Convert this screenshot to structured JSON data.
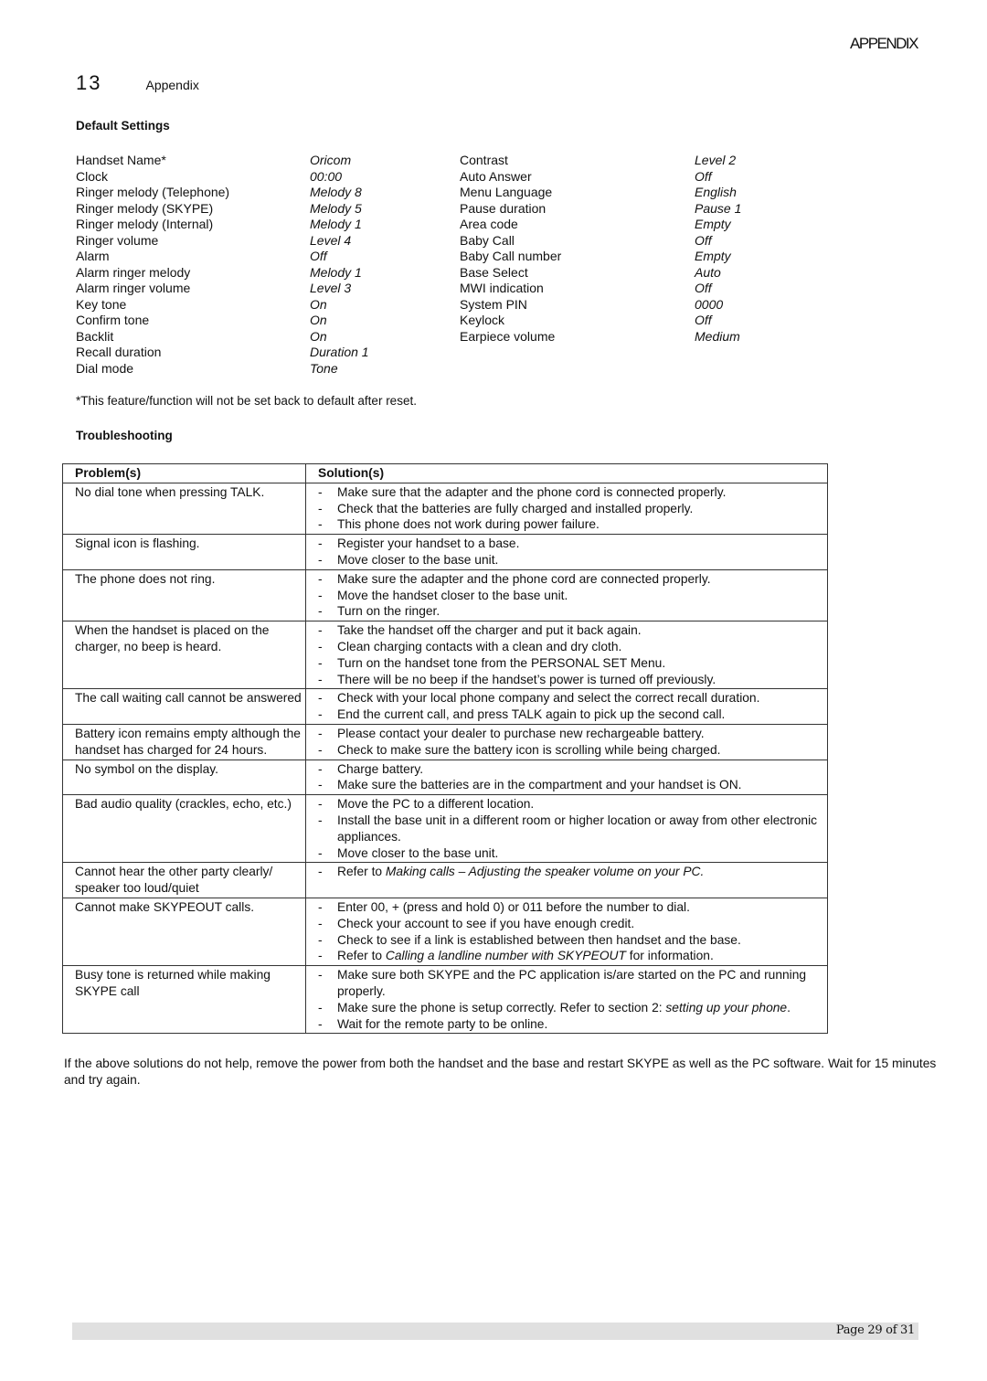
{
  "header": {
    "title": "APPENDIX"
  },
  "chapter": {
    "number": "13",
    "name": "Appendix"
  },
  "default_settings": {
    "heading": "Default Settings",
    "left": [
      {
        "name": "Handset Name*",
        "value": "Oricom"
      },
      {
        "name": "Clock",
        "value": "00:00"
      },
      {
        "name": "Ringer melody  (Telephone)",
        "value": "Melody 8"
      },
      {
        "name": "Ringer melody (SKYPE)",
        "value": "Melody 5"
      },
      {
        "name": "Ringer melody (Internal)",
        "value": "Melody 1"
      },
      {
        "name": "Ringer volume",
        "value": "Level 4"
      },
      {
        "name": "Alarm",
        "value": "Off"
      },
      {
        "name": "Alarm ringer melody",
        "value": "Melody 1"
      },
      {
        "name": "Alarm ringer volume",
        "value": "Level 3"
      },
      {
        "name": "Key tone",
        "value": "On"
      },
      {
        "name": "Confirm tone",
        "value": "On"
      },
      {
        "name": "Backlit",
        "value": "On"
      },
      {
        "name": "Recall duration",
        "value": "Duration 1"
      },
      {
        "name": "Dial mode",
        "value": "Tone"
      }
    ],
    "right": [
      {
        "name": "Contrast",
        "value": "Level 2"
      },
      {
        "name": "Auto Answer",
        "value": "Off"
      },
      {
        "name": "Menu Language",
        "value": "English"
      },
      {
        "name": "Pause duration",
        "value": "Pause 1"
      },
      {
        "name": "Area code",
        "value": "Empty"
      },
      {
        "name": "Baby Call",
        "value": "Off"
      },
      {
        "name": "Baby Call number",
        "value": "Empty"
      },
      {
        "name": "Base Select",
        "value": "Auto"
      },
      {
        "name": "MWI indication",
        "value": "Off"
      },
      {
        "name": "System PIN",
        "value": "0000"
      },
      {
        "name": "Keylock",
        "value": "Off"
      },
      {
        "name": "Earpiece volume",
        "value": "Medium"
      }
    ],
    "footnote": "*This feature/function will not be set back to default after reset."
  },
  "troubleshooting": {
    "heading": "Troubleshooting",
    "columns": [
      "Problem(s)",
      "Solution(s)"
    ],
    "rows": [
      {
        "problem": "No dial tone when pressing TALK.",
        "solutions": [
          [
            {
              "t": "Make sure that the adapter and the phone cord is connected properly."
            }
          ],
          [
            {
              "t": "Check that the batteries are fully charged and installed properly."
            }
          ],
          [
            {
              "t": "This phone does not work during power failure."
            }
          ]
        ]
      },
      {
        "problem": "Signal icon is flashing.",
        "solutions": [
          [
            {
              "t": "Register your handset to a base."
            }
          ],
          [
            {
              "t": "Move closer to the base unit."
            }
          ]
        ]
      },
      {
        "problem": "The phone does not ring.",
        "solutions": [
          [
            {
              "t": "Make sure the adapter and the phone cord are connected properly."
            }
          ],
          [
            {
              "t": "Move the handset closer to the base unit."
            }
          ],
          [
            {
              "t": "Turn on the ringer."
            }
          ]
        ]
      },
      {
        "problem": "When the handset is placed on the charger, no beep is heard.",
        "solutions": [
          [
            {
              "t": "Take the handset off the charger and put it back again."
            }
          ],
          [
            {
              "t": "Clean charging contacts with a clean and dry cloth."
            }
          ],
          [
            {
              "t": "Turn on the handset tone from the PERSONAL SET Menu."
            }
          ],
          [
            {
              "t": "There will be no beep if the handset’s power is turned off previously."
            }
          ]
        ]
      },
      {
        "problem": "The call waiting call cannot be answered",
        "solutions": [
          [
            {
              "t": "Check with your local phone company and select the correct recall duration."
            }
          ],
          [
            {
              "t": "End the current call, and press TALK again to pick up the second call."
            }
          ]
        ]
      },
      {
        "problem": "Battery icon remains empty although the handset has charged for 24 hours.",
        "solutions": [
          [
            {
              "t": "Please contact your dealer to purchase new rechargeable battery."
            }
          ],
          [
            {
              "t": "Check to make sure the battery icon is scrolling while being charged."
            }
          ]
        ]
      },
      {
        "problem": "No symbol on the display.",
        "solutions": [
          [
            {
              "t": "Charge battery."
            }
          ],
          [
            {
              "t": "Make sure the batteries are in the compartment and your handset is ON."
            }
          ]
        ]
      },
      {
        "problem": "Bad audio quality (crackles, echo, etc.)",
        "solutions": [
          [
            {
              "t": "Move the PC to a different location."
            }
          ],
          [
            {
              "t": "Install the base unit in a different room or higher location or away from other electronic appliances."
            }
          ],
          [
            {
              "t": "Move closer to the base unit."
            }
          ]
        ]
      },
      {
        "problem": "Cannot hear the other party clearly/ speaker too loud/quiet",
        "solutions": [
          [
            {
              "t": "Refer to "
            },
            {
              "t": "Making calls – Adjusting the speaker volume on your PC.",
              "i": true
            }
          ]
        ]
      },
      {
        "problem": "Cannot make SKYPEOUT calls.",
        "solutions": [
          [
            {
              "t": "Enter 00, + (press and hold 0) or 011 before the number to dial."
            }
          ],
          [
            {
              "t": "Check your account to see if you have enough credit."
            }
          ],
          [
            {
              "t": "Check to see if a link is established between then handset and the base."
            }
          ],
          [
            {
              "t": "Refer to "
            },
            {
              "t": "Calling a landline number with SKYPEOUT",
              "i": true
            },
            {
              "t": " for information."
            }
          ]
        ]
      },
      {
        "problem": "Busy tone is returned while making SKYPE call",
        "solutions": [
          [
            {
              "t": "Make sure both SKYPE and the PC application is/are started on the PC and running properly."
            }
          ],
          [
            {
              "t": "Make sure the phone is setup correctly.  Refer to section 2: "
            },
            {
              "t": "setting up your phone",
              "i": true
            },
            {
              "t": "."
            }
          ],
          [
            {
              "t": "Wait for the remote party to be online."
            }
          ]
        ]
      }
    ],
    "closing": "If the above solutions do not help, remove the power from both the handset and the base and restart SKYPE as well as the PC software. Wait for 15 minutes and try again."
  },
  "footer": {
    "page": "Page 29 of 31"
  }
}
